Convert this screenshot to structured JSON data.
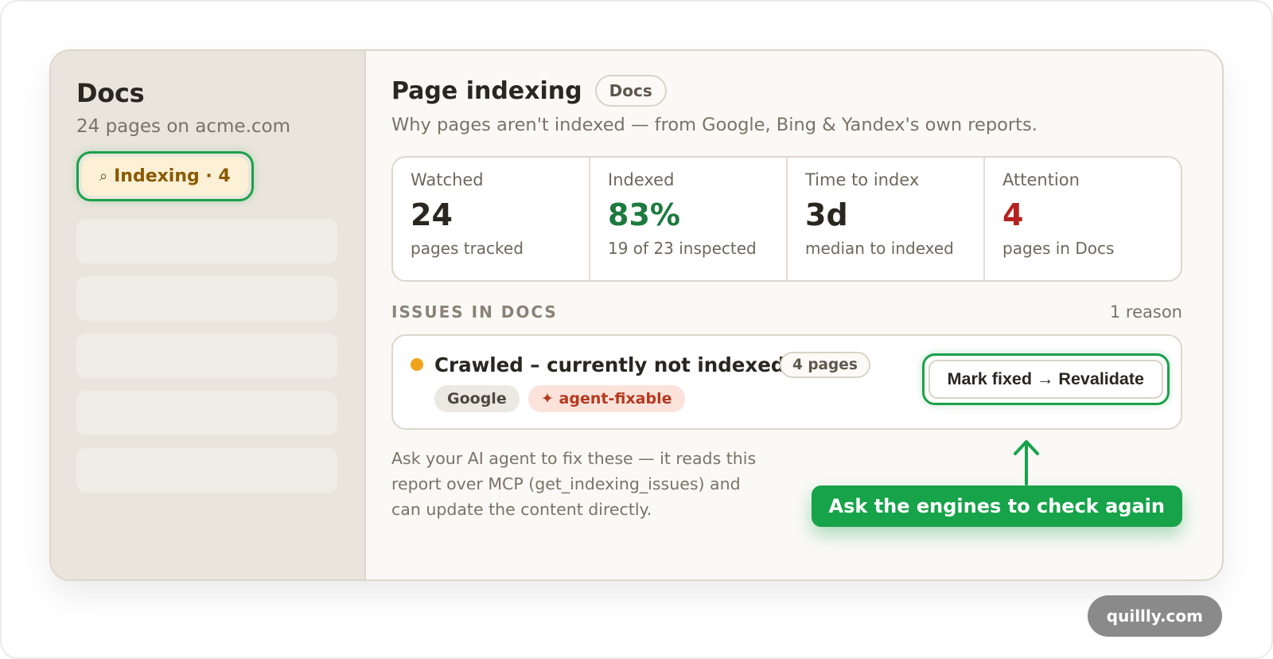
{
  "sidebar": {
    "title": "Docs",
    "subtitle": "24 pages on acme.com",
    "active_item": {
      "icon": "search-icon",
      "glyph": "⌕",
      "label": "Indexing · 4"
    },
    "placeholder_count": 5
  },
  "main": {
    "title": "Page indexing",
    "scope_chip": "Docs",
    "description": "Why pages aren't indexed — from Google, Bing & Yandex's own reports.",
    "stats": [
      {
        "label": "Watched",
        "value": "24",
        "sub": "pages tracked"
      },
      {
        "label": "Indexed",
        "value": "83%",
        "sub": "19 of 23 inspected",
        "color": "#1c7a3e"
      },
      {
        "label": "Time to index",
        "value": "3d",
        "sub": "median to indexed"
      },
      {
        "label": "Attention",
        "value": "4",
        "sub": "pages in Docs",
        "color": "#b52222"
      }
    ],
    "issues_title": "ISSUES IN DOCS",
    "issues_count": "1 reason",
    "issue": {
      "status_color": "#f0a21b",
      "name": "Crawled – currently not indexed",
      "pages": "4 pages",
      "engine_tag": "Google",
      "agent_tag": "✦ agent-fixable",
      "action_label": "Mark fixed → Revalidate"
    },
    "help_text": "Ask your AI agent to fix these — it reads this report over MCP (get_indexing_issues) and can update the content directly.",
    "callout": "Ask the engines to check again"
  },
  "watermark": "quillly.com",
  "colors": {
    "accent_green": "#1ba14a",
    "callout_green": "#17a34a",
    "warning_orange": "#f0a21b"
  }
}
